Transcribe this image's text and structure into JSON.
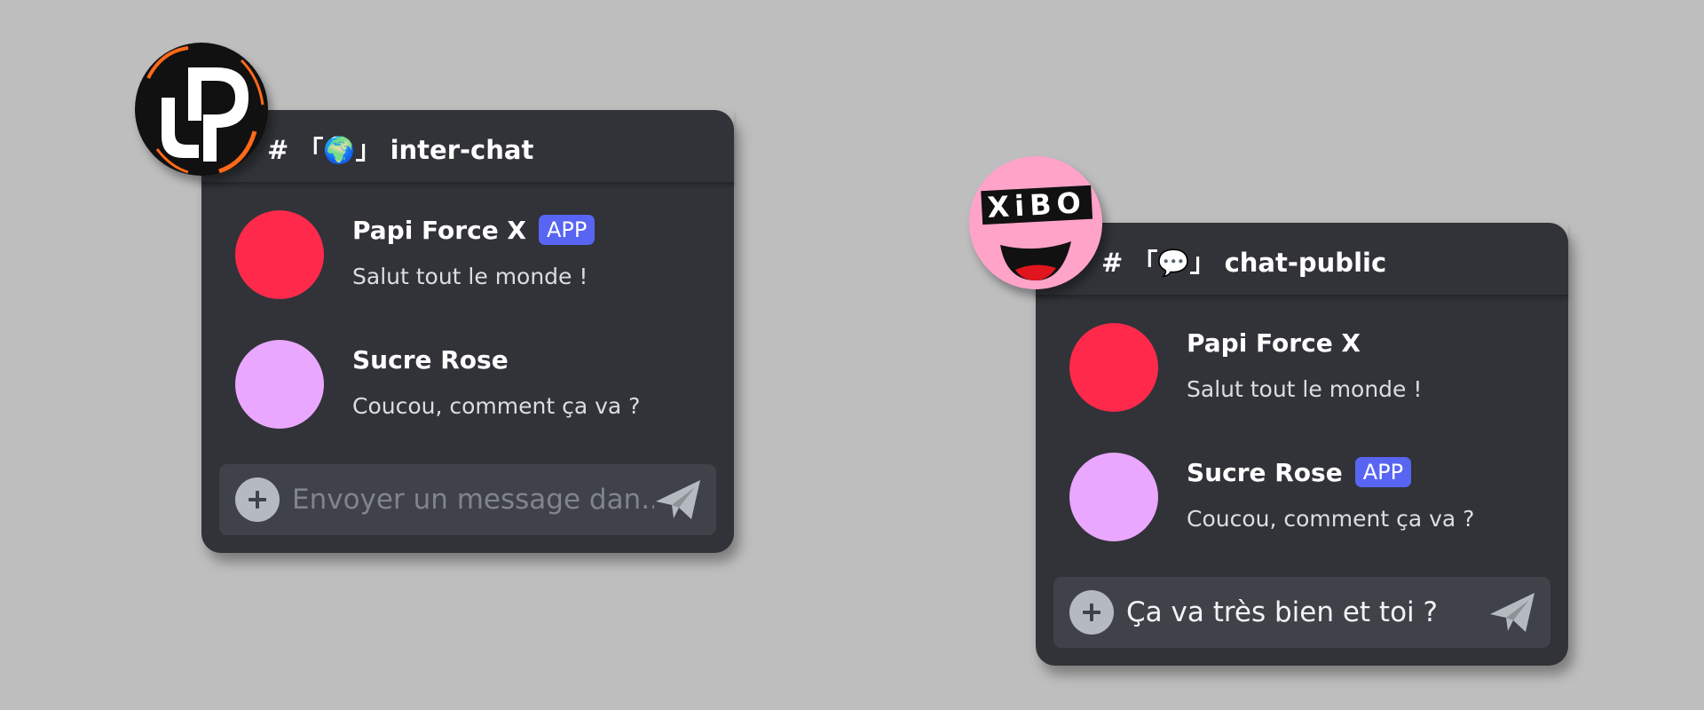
{
  "colors": {
    "background": "#bebebe",
    "card": "#313338",
    "composer": "#40424a",
    "badge": "#5865f2",
    "avatar_papi": "#ff2a4b",
    "avatar_sucre": "#eaa7ff",
    "server_xibo_bg": "#ffa3c9"
  },
  "left_card": {
    "server_icon": "jp-logo-icon",
    "channel_name": "# 「🌍」 inter-chat",
    "messages": [
      {
        "author": "Papi Force X",
        "badge": "APP",
        "text": "Salut tout le monde !"
      },
      {
        "author": "Sucre Rose",
        "text": "Coucou, comment ça va ?"
      }
    ],
    "composer": {
      "placeholder": "Envoyer un message dan..."
    }
  },
  "right_card": {
    "server_icon": "xibo-face-icon",
    "server_icon_text": "XiBO",
    "channel_name": "# 「💬」 chat-public",
    "messages": [
      {
        "author": "Papi Force X",
        "text": "Salut tout le monde !"
      },
      {
        "author": "Sucre Rose",
        "badge": "APP",
        "text": "Coucou, comment ça va ?"
      }
    ],
    "composer": {
      "value": "Ça va très bien et toi ?"
    }
  }
}
